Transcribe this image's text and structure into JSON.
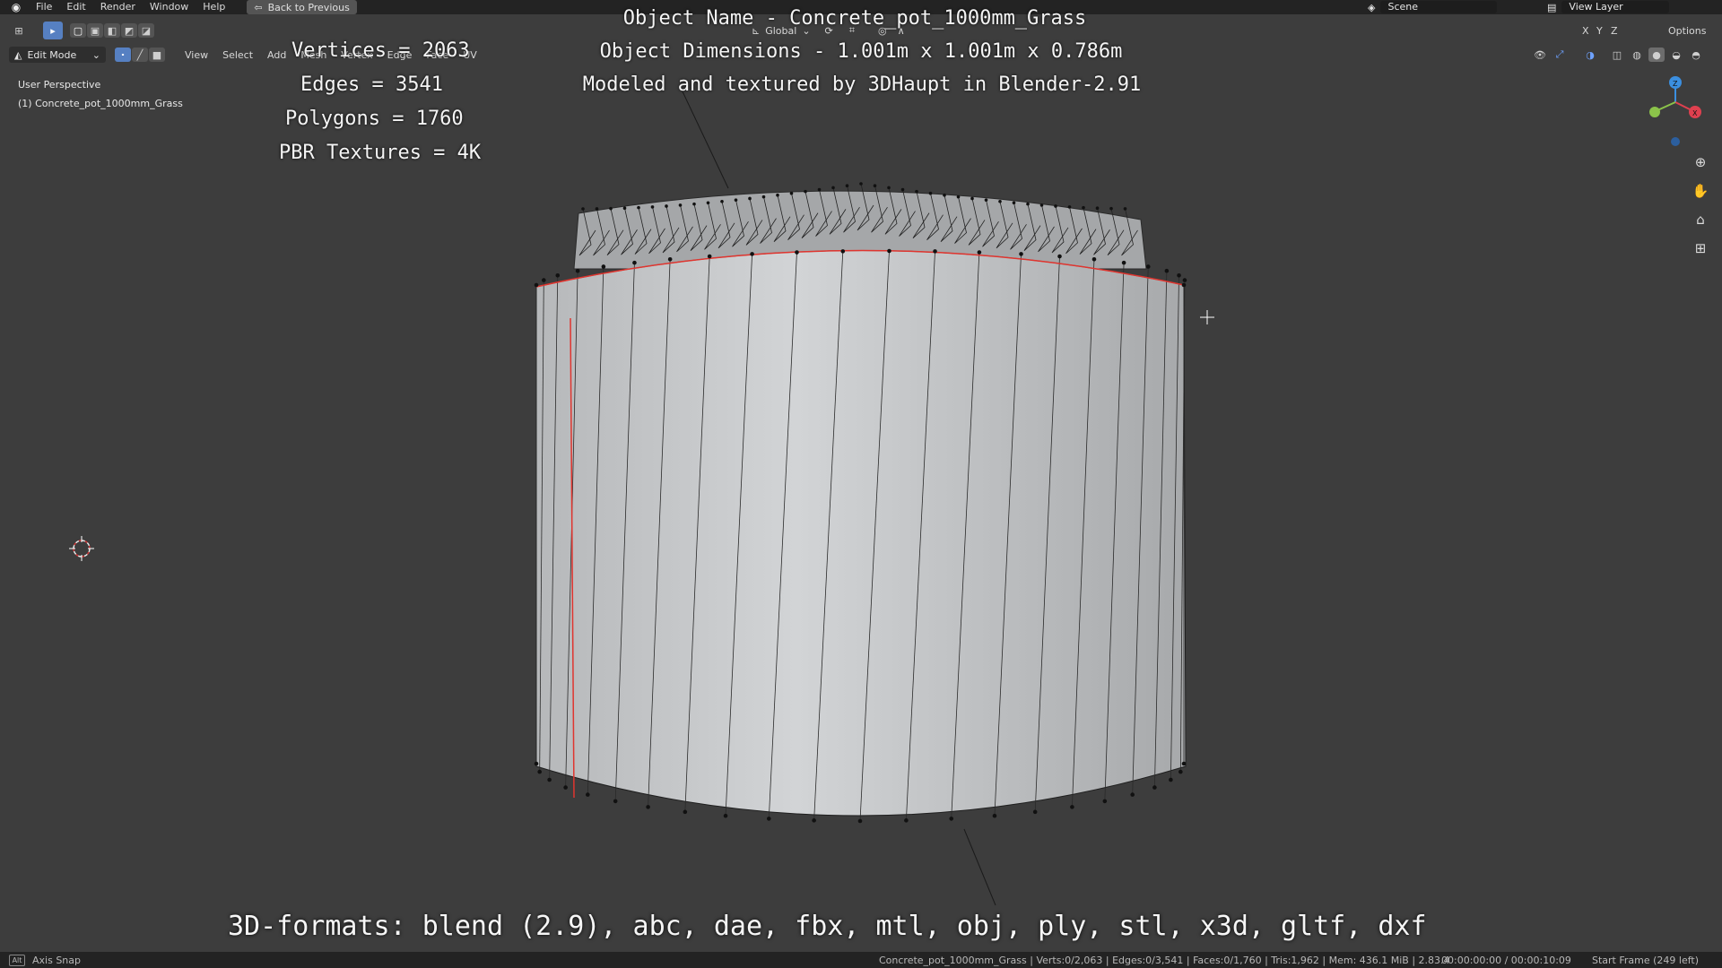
{
  "menu": {
    "items": [
      "File",
      "Edit",
      "Render",
      "Window",
      "Help"
    ],
    "back_button": "Back to Previous"
  },
  "scene": {
    "label": "Scene",
    "view_layer": "View Layer"
  },
  "tool_header": {
    "transform_orientation": "Global",
    "axes": [
      "X",
      "Y",
      "Z"
    ],
    "options": "Options"
  },
  "mode_header": {
    "mode": "Edit Mode",
    "menus": [
      "View",
      "Select",
      "Add",
      "Mesh",
      "Vertex",
      "Edge",
      "Face",
      "UV"
    ]
  },
  "viewport": {
    "perspective": "User Perspective",
    "object": "(1) Concrete_pot_1000mm_Grass"
  },
  "overlay_text": {
    "vertices": "Vertices = 2063",
    "edges": "Edges = 3541",
    "polygons": "Polygons = 1760",
    "textures": "PBR Textures = 4K",
    "object_name": "Object Name - Concrete_pot_1000mm_Grass",
    "object_dimensions": "Object Dimensions -  1.001m x 1.001m x 0.786m",
    "credits": "Modeled and textured by 3DHaupt in Blender-2.91",
    "formats": "3D-formats: blend (2.9), abc, dae, fbx, mtl, obj, ply, stl, x3d, gltf, dxf"
  },
  "statusbar": {
    "key": "Alt",
    "hint": "Axis Snap",
    "stats": "Concrete_pot_1000mm_Grass | Verts:0/2,063 | Edges:0/3,541 | Faces:0/1,760 | Tris:1,962 | Mem: 436.1 MiB | 2.83.4",
    "time": "00:00:00:00 / 00:00:10:09",
    "frame": "Start Frame (249 left)"
  },
  "colors": {
    "viewport_bg": "#3d3d3d",
    "mesh_face": "#c9cbcd",
    "seam": "#e0352f",
    "selection_blue": "#5680c2",
    "axis_x": "#e0404f",
    "axis_y": "#8bc34a",
    "axis_z": "#3b8fe0"
  },
  "icons": [
    "blender-logo-icon",
    "select-box-icon",
    "cursor-icon",
    "crosshair-icon",
    "zoom-icon",
    "hand-icon",
    "camera-icon",
    "grid-icon"
  ]
}
